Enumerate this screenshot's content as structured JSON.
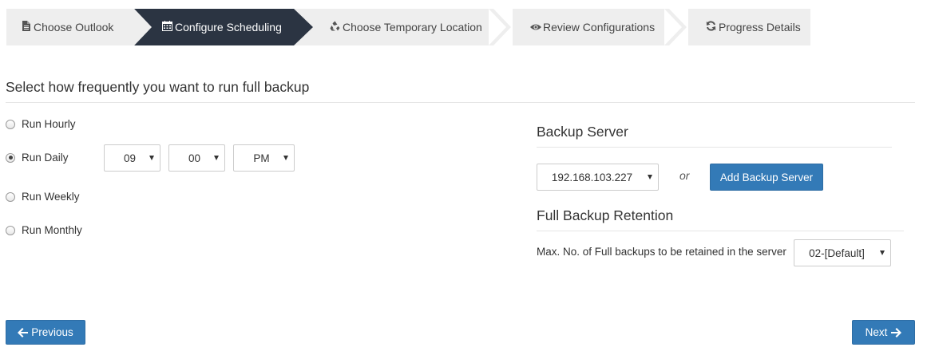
{
  "wizard": {
    "steps": [
      {
        "label": "Choose Outlook",
        "icon": "file-icon",
        "active": false
      },
      {
        "label": "Configure Scheduling",
        "icon": "calendar-icon",
        "active": true
      },
      {
        "label": "Choose Temporary Location",
        "icon": "recycle-icon",
        "active": false
      },
      {
        "label": "Review Configurations",
        "icon": "eye-icon",
        "active": false
      },
      {
        "label": "Progress Details",
        "icon": "refresh-icon",
        "active": false
      }
    ],
    "colors": {
      "inactive": "#eeeeee",
      "active": "#2b3442"
    }
  },
  "schedule": {
    "title": "Select how frequently you want to run full backup",
    "options": [
      {
        "label": "Run Hourly",
        "checked": false
      },
      {
        "label": "Run Daily",
        "checked": true
      },
      {
        "label": "Run Weekly",
        "checked": false
      },
      {
        "label": "Run Monthly",
        "checked": false
      }
    ],
    "hour": "09",
    "minute": "00",
    "ampm": "PM"
  },
  "backup_server": {
    "title": "Backup Server",
    "selected": "192.168.103.227",
    "or_label": "or",
    "add_button": "Add Backup Server"
  },
  "retention": {
    "title": "Full Backup Retention",
    "label": "Max. No. of Full backups to be retained in the server",
    "selected": "02-[Default]"
  },
  "footer": {
    "previous": "Previous",
    "next": "Next"
  },
  "colors": {
    "primary": "#337ab7"
  }
}
